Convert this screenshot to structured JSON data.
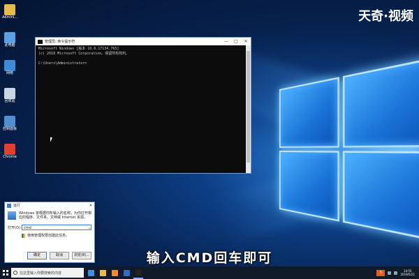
{
  "brand_logo_text": "天奇·视频",
  "desktop_icons": [
    {
      "name": "admin-folder",
      "label": "Admini...",
      "color": "#e8b84a"
    },
    {
      "name": "computer",
      "label": "此电脑",
      "color": "#5aa0e6"
    },
    {
      "name": "network",
      "label": "网络",
      "color": "#3c8ad8"
    },
    {
      "name": "recycle-bin",
      "label": "回收站",
      "color": "#c9d6e3"
    },
    {
      "name": "control-panel",
      "label": "控制面板",
      "color": "#4f8fd0"
    },
    {
      "name": "chrome",
      "label": "Chrome",
      "color": "#e0402f"
    }
  ],
  "cmd_window": {
    "title": "管理员: 命令提示符",
    "lines": [
      "Microsoft Windows [版本 10.0.17134.765]",
      "(c) 2018 Microsoft Corporation。保留所有权利。",
      "",
      "C:\\Users\\Administrator>"
    ],
    "controls": {
      "minimize": "—",
      "maximize": "□",
      "close": "✕"
    }
  },
  "run_dialog": {
    "title": "运行",
    "description": "Windows 将根据你所输入的名称，为你打开相应的程序、文件夹、文档或 Internet 资源。",
    "open_label": "打开(O):",
    "open_value": "cmd",
    "admin_note": "使用管理权限创建此任务。",
    "buttons": {
      "ok": "确定",
      "cancel": "取消",
      "browse": "浏览(B)..."
    },
    "close": "✕"
  },
  "subtitle": "输入CMD回车即可",
  "taskbar": {
    "search_placeholder": "在这里输入你要搜索的内容",
    "apps": [
      {
        "name": "edge",
        "color": "#3b8fe0"
      },
      {
        "name": "file-explorer",
        "color": "#e7b84a"
      },
      {
        "name": "media-player",
        "color": "#f08a24"
      },
      {
        "name": "app-blue",
        "color": "#2f6cc5"
      },
      {
        "name": "command-prompt",
        "color": "#222"
      }
    ],
    "tray_badge": "5",
    "time": "14:55",
    "date": "2019/5/21"
  }
}
